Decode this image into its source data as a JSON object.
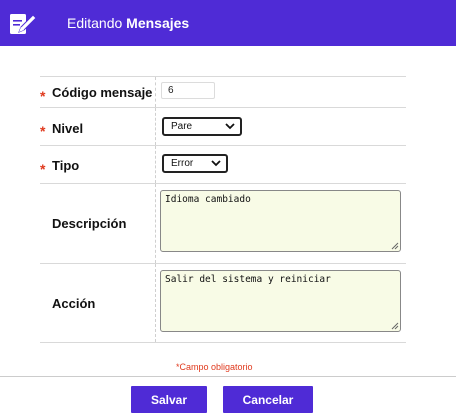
{
  "header": {
    "title_prefix": "Editando",
    "title_entity": "Mensajes",
    "icon": "edit-document-icon"
  },
  "form": {
    "required_mark": "*",
    "fields": {
      "codigo": {
        "label": "Código mensaje",
        "value": "6",
        "required": true
      },
      "nivel": {
        "label": "Nivel",
        "value": "Pare",
        "required": true
      },
      "tipo": {
        "label": "Tipo",
        "value": "Error",
        "required": true
      },
      "descripcion": {
        "label": "Descripción",
        "value": "Idioma cambiado",
        "required": false
      },
      "accion": {
        "label": "Acción",
        "value": "Salir del sistema y reiniciar",
        "required": false
      }
    },
    "required_note": "*Campo obligatorio"
  },
  "buttons": {
    "save_label": "Salvar",
    "cancel_label": "Cancelar"
  },
  "colors": {
    "brand": "#4f2bd6",
    "required": "#e03a1e",
    "textarea_bg": "#f8fbe6"
  }
}
